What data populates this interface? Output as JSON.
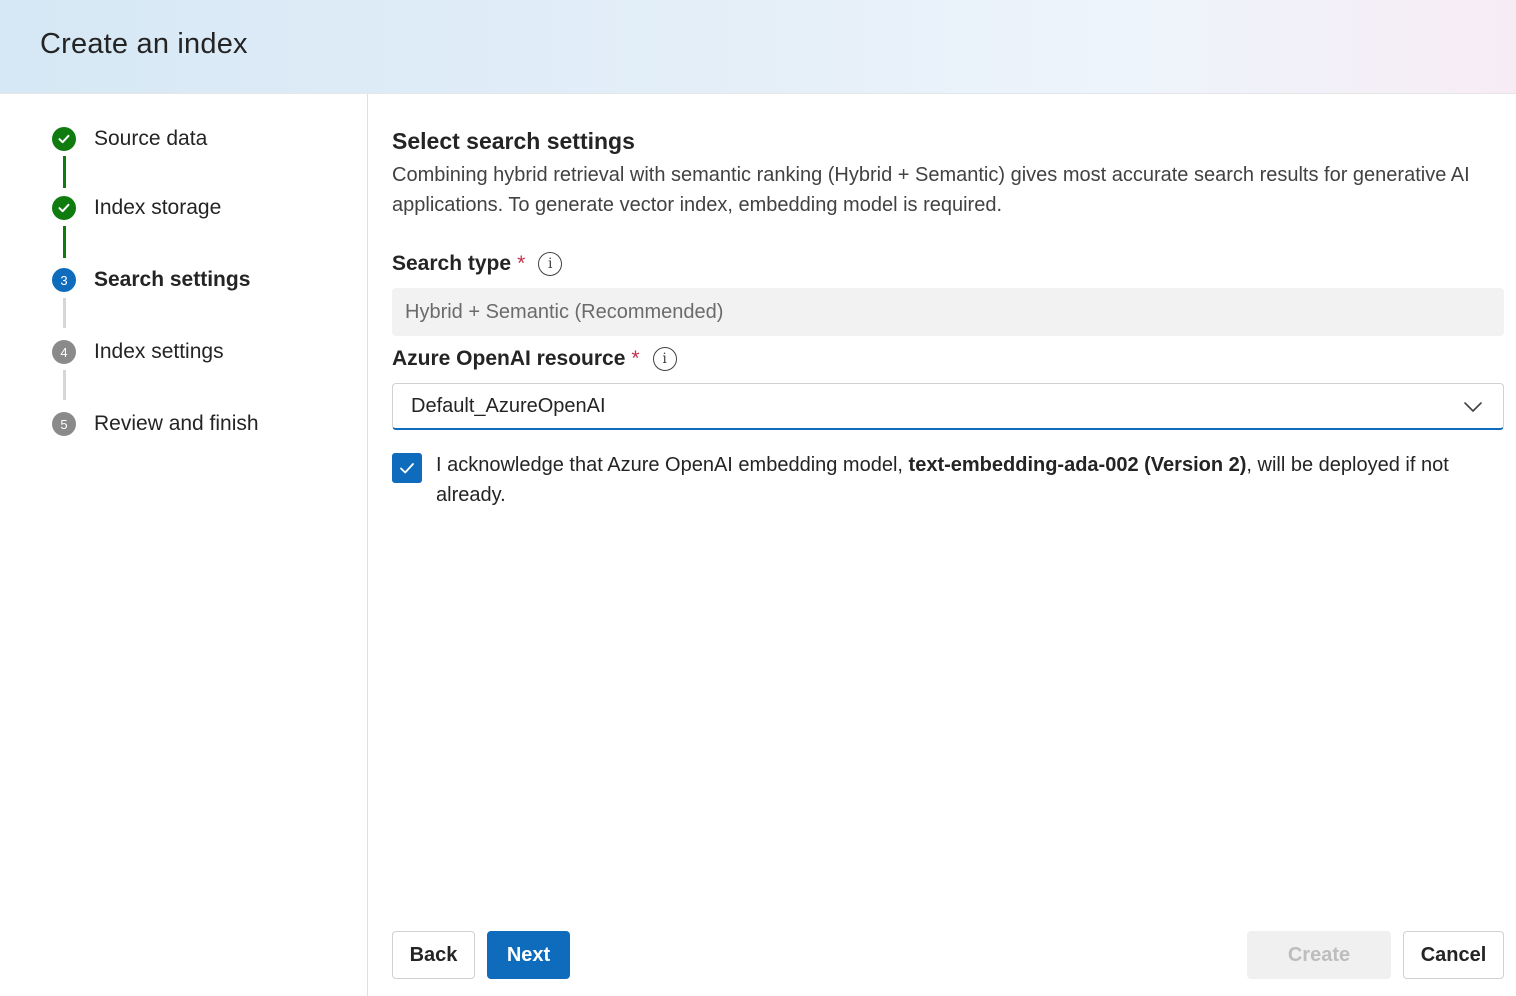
{
  "header": {
    "title": "Create an index"
  },
  "steps": [
    {
      "label": "Source data",
      "status": "completed",
      "number": "1"
    },
    {
      "label": "Index storage",
      "status": "completed",
      "number": "2"
    },
    {
      "label": "Search settings",
      "status": "active",
      "number": "3"
    },
    {
      "label": "Index settings",
      "status": "pending",
      "number": "4"
    },
    {
      "label": "Review and finish",
      "status": "pending",
      "number": "5"
    }
  ],
  "main": {
    "title": "Select search settings",
    "description": "Combining hybrid retrieval with semantic ranking (Hybrid + Semantic) gives most accurate search results for generative AI applications. To generate vector index, embedding model is required.",
    "search_type": {
      "label": "Search type",
      "required_mark": "*",
      "value": "Hybrid + Semantic (Recommended)"
    },
    "openai_resource": {
      "label": "Azure OpenAI resource",
      "required_mark": "*",
      "value": "Default_AzureOpenAI"
    },
    "acknowledge": {
      "checked": true,
      "text_before": "I acknowledge that Azure OpenAI embedding model, ",
      "model_name": "text-embedding-ada-002 (Version 2)",
      "text_after": ", will be deployed if not already."
    }
  },
  "footer": {
    "back_label": "Back",
    "next_label": "Next",
    "create_label": "Create",
    "cancel_label": "Cancel"
  },
  "colors": {
    "completed": "#107c10",
    "active": "#0f6cbd",
    "pending": "#8a8a8a",
    "required": "#c4314b"
  },
  "icons": {
    "completed_step": "checkmark-icon",
    "info": "info-icon",
    "dropdown": "chevron-down-icon",
    "checkbox": "checkmark-icon"
  }
}
